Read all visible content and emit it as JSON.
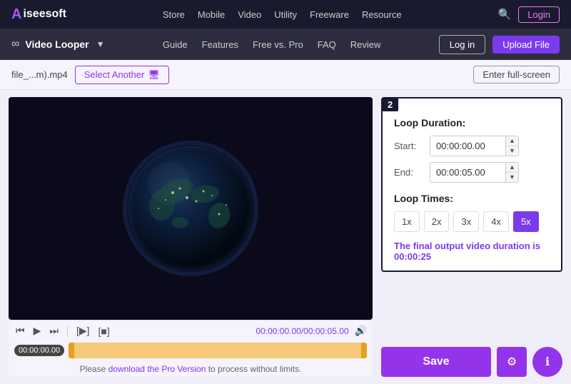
{
  "top_nav": {
    "logo_text": "iseesoft",
    "links": [
      "Store",
      "Mobile",
      "Video",
      "Utility",
      "Freeware",
      "Resource"
    ],
    "login_label": "Login"
  },
  "sub_nav": {
    "tool_name": "Video Looper",
    "links": [
      "Guide",
      "Features",
      "Free vs. Pro",
      "FAQ",
      "Review"
    ],
    "log_in_label": "Log in",
    "upload_label": "Upload File"
  },
  "toolbar": {
    "filename": "file_...m).mp4",
    "select_another_label": "Select Another",
    "fullscreen_label": "Enter full-screen"
  },
  "video": {
    "time_current": "00:00:00.00",
    "time_total": "/00:00:05.00",
    "timestamp_badge": "00:00:00.00"
  },
  "loop_settings": {
    "step_number": "2",
    "loop_duration_label": "Loop Duration:",
    "start_label": "Start:",
    "start_value": "00:00:00.00",
    "end_label": "End:",
    "end_value": "00:00:05.00",
    "loop_times_label": "Loop Times:",
    "loop_buttons": [
      "1x",
      "2x",
      "3x",
      "4x",
      "5x"
    ],
    "active_loop": "5x",
    "output_text": "The final output video duration is ",
    "output_duration": "00:00:25"
  },
  "save_bar": {
    "save_label": "Save"
  },
  "notice": {
    "text_before": "Please ",
    "link_text": "download the Pro Version",
    "text_after": " to process without limits."
  }
}
